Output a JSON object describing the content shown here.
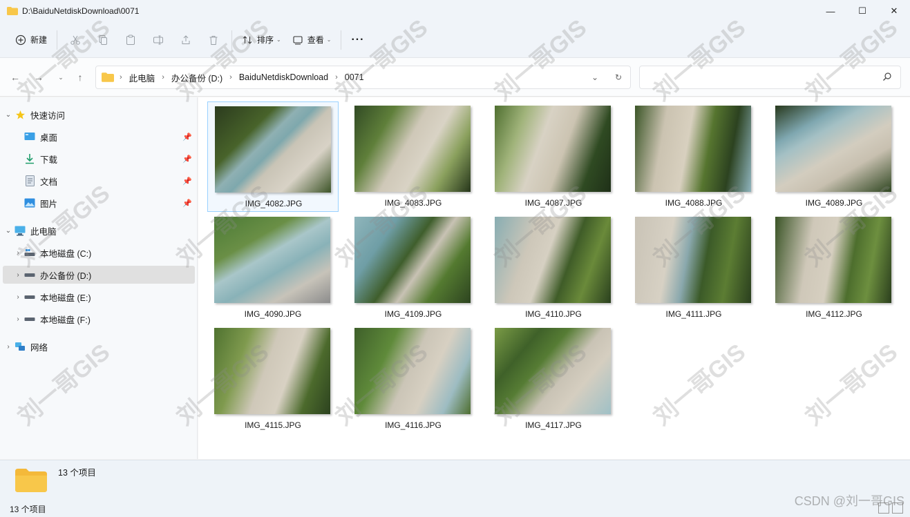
{
  "window": {
    "title": "D:\\BaiduNetdiskDownload\\0071",
    "minimize": "—",
    "maximize": "☐",
    "close": "✕"
  },
  "toolbar": {
    "new_label": "新建",
    "sort_label": "排序",
    "view_label": "查看",
    "more_label": "···"
  },
  "address": {
    "crumbs": [
      "此电脑",
      "办公备份 (D:)",
      "BaiduNetdiskDownload",
      "0071"
    ]
  },
  "nav": {
    "quick_access": "快速访问",
    "desktop": "桌面",
    "downloads": "下载",
    "documents": "文档",
    "pictures": "图片",
    "this_pc": "此电脑",
    "drive_c": "本地磁盘 (C:)",
    "drive_d": "办公备份 (D:)",
    "drive_e": "本地磁盘 (E:)",
    "drive_f": "本地磁盘 (F:)",
    "network": "网络"
  },
  "files": [
    {
      "name": "IMG_4082.JPG"
    },
    {
      "name": "IMG_4083.JPG"
    },
    {
      "name": "IMG_4087.JPG"
    },
    {
      "name": "IMG_4088.JPG"
    },
    {
      "name": "IMG_4089.JPG"
    },
    {
      "name": "IMG_4090.JPG"
    },
    {
      "name": "IMG_4109.JPG"
    },
    {
      "name": "IMG_4110.JPG"
    },
    {
      "name": "IMG_4111.JPG"
    },
    {
      "name": "IMG_4112.JPG"
    },
    {
      "name": "IMG_4115.JPG"
    },
    {
      "name": "IMG_4116.JPG"
    },
    {
      "name": "IMG_4117.JPG"
    }
  ],
  "details": {
    "count": "13 个项目"
  },
  "status": {
    "count": "13 个项目"
  },
  "watermark": {
    "text": "刘一哥GIS",
    "csdn": "CSDN @刘一哥GIS"
  },
  "colors": {
    "accent": "#0067c0",
    "folder": "#f8c74a",
    "selection": "#99d1ff"
  }
}
